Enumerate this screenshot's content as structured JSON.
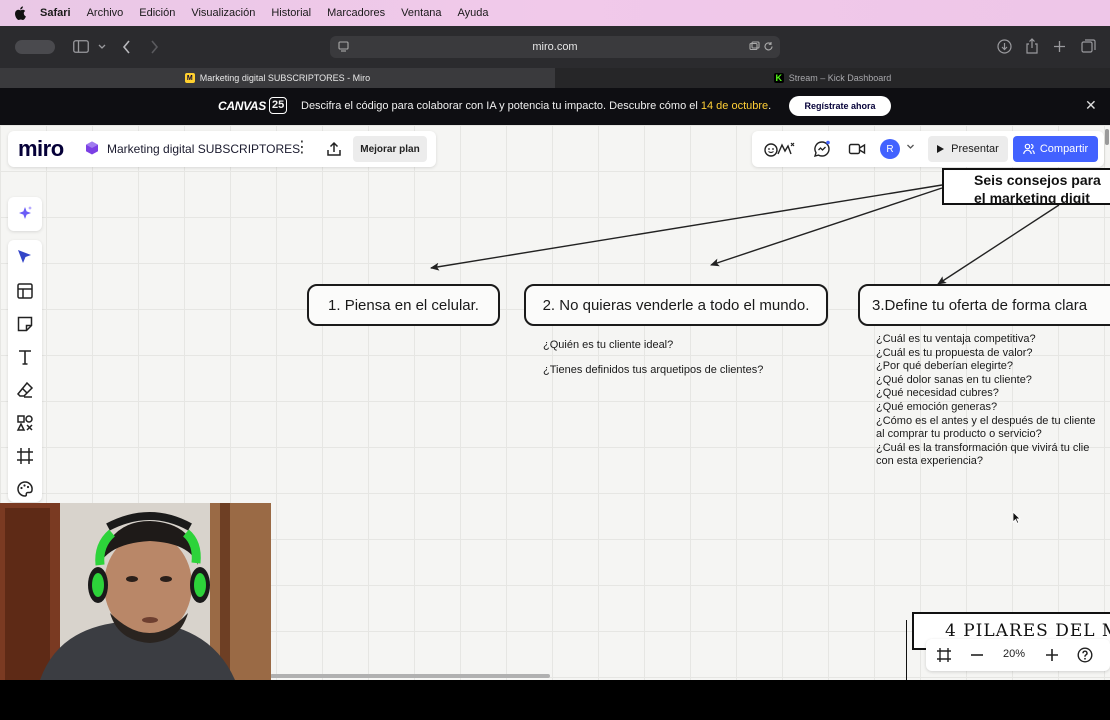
{
  "menubar": {
    "items": [
      "Safari",
      "Archivo",
      "Edición",
      "Visualización",
      "Historial",
      "Marcadores",
      "Ventana",
      "Ayuda"
    ]
  },
  "browser": {
    "url": "miro.com",
    "tabs": [
      {
        "label": "Marketing digital SUBSCRIPTORES - Miro",
        "favicon": "miro-icon",
        "active": true
      },
      {
        "label": "Stream – Kick Dashboard",
        "favicon": "kick-icon",
        "active": false
      }
    ]
  },
  "banner": {
    "logo_text": "CANVAS",
    "logo_badge": "25",
    "message_pre": "Descifra el código para colaborar con IA y potencia tu impacto. Descubre cómo el ",
    "message_date": "14 de octubre",
    "message_post": ".",
    "cta": "Regístrate ahora",
    "date_color": "#ffcf36"
  },
  "board": {
    "logo": "miro",
    "title": "Marketing digital SUBSCRIPTORES",
    "upgrade_label": "Mejorar plan",
    "present_label": "Presentar",
    "share_label": "Compartir",
    "avatar_initial": "R",
    "accent_color": "#4262ff"
  },
  "diagram": {
    "title_lines": [
      "Seis consejos para",
      "el marketing digit"
    ],
    "cards": [
      {
        "label": "1. Piensa en el celular."
      },
      {
        "label": "2. No quieras venderle a todo el mundo."
      },
      {
        "label": "3.Define tu oferta de forma clara"
      }
    ],
    "card2_questions": [
      "¿Quién es tu cliente ideal?",
      "¿Tienes definidos tus arquetipos de clientes?"
    ],
    "card3_questions": [
      "¿Cuál es tu ventaja competitiva?",
      "¿Cuál es tu propuesta de valor?",
      "¿Por qué deberían elegirte?",
      "¿Qué dolor sanas en tu cliente?",
      "¿Qué necesidad cubres?",
      "¿Qué emoción generas?",
      "¿Cómo es el antes y el después de tu cliente",
      "al comprar tu producto o servicio?",
      "¿Cuál es la transformación que vivirá tu clie",
      "con esta experiencia?"
    ],
    "pillars_title": "4 PILARES DEL M"
  },
  "zoom": {
    "level": "20%"
  }
}
